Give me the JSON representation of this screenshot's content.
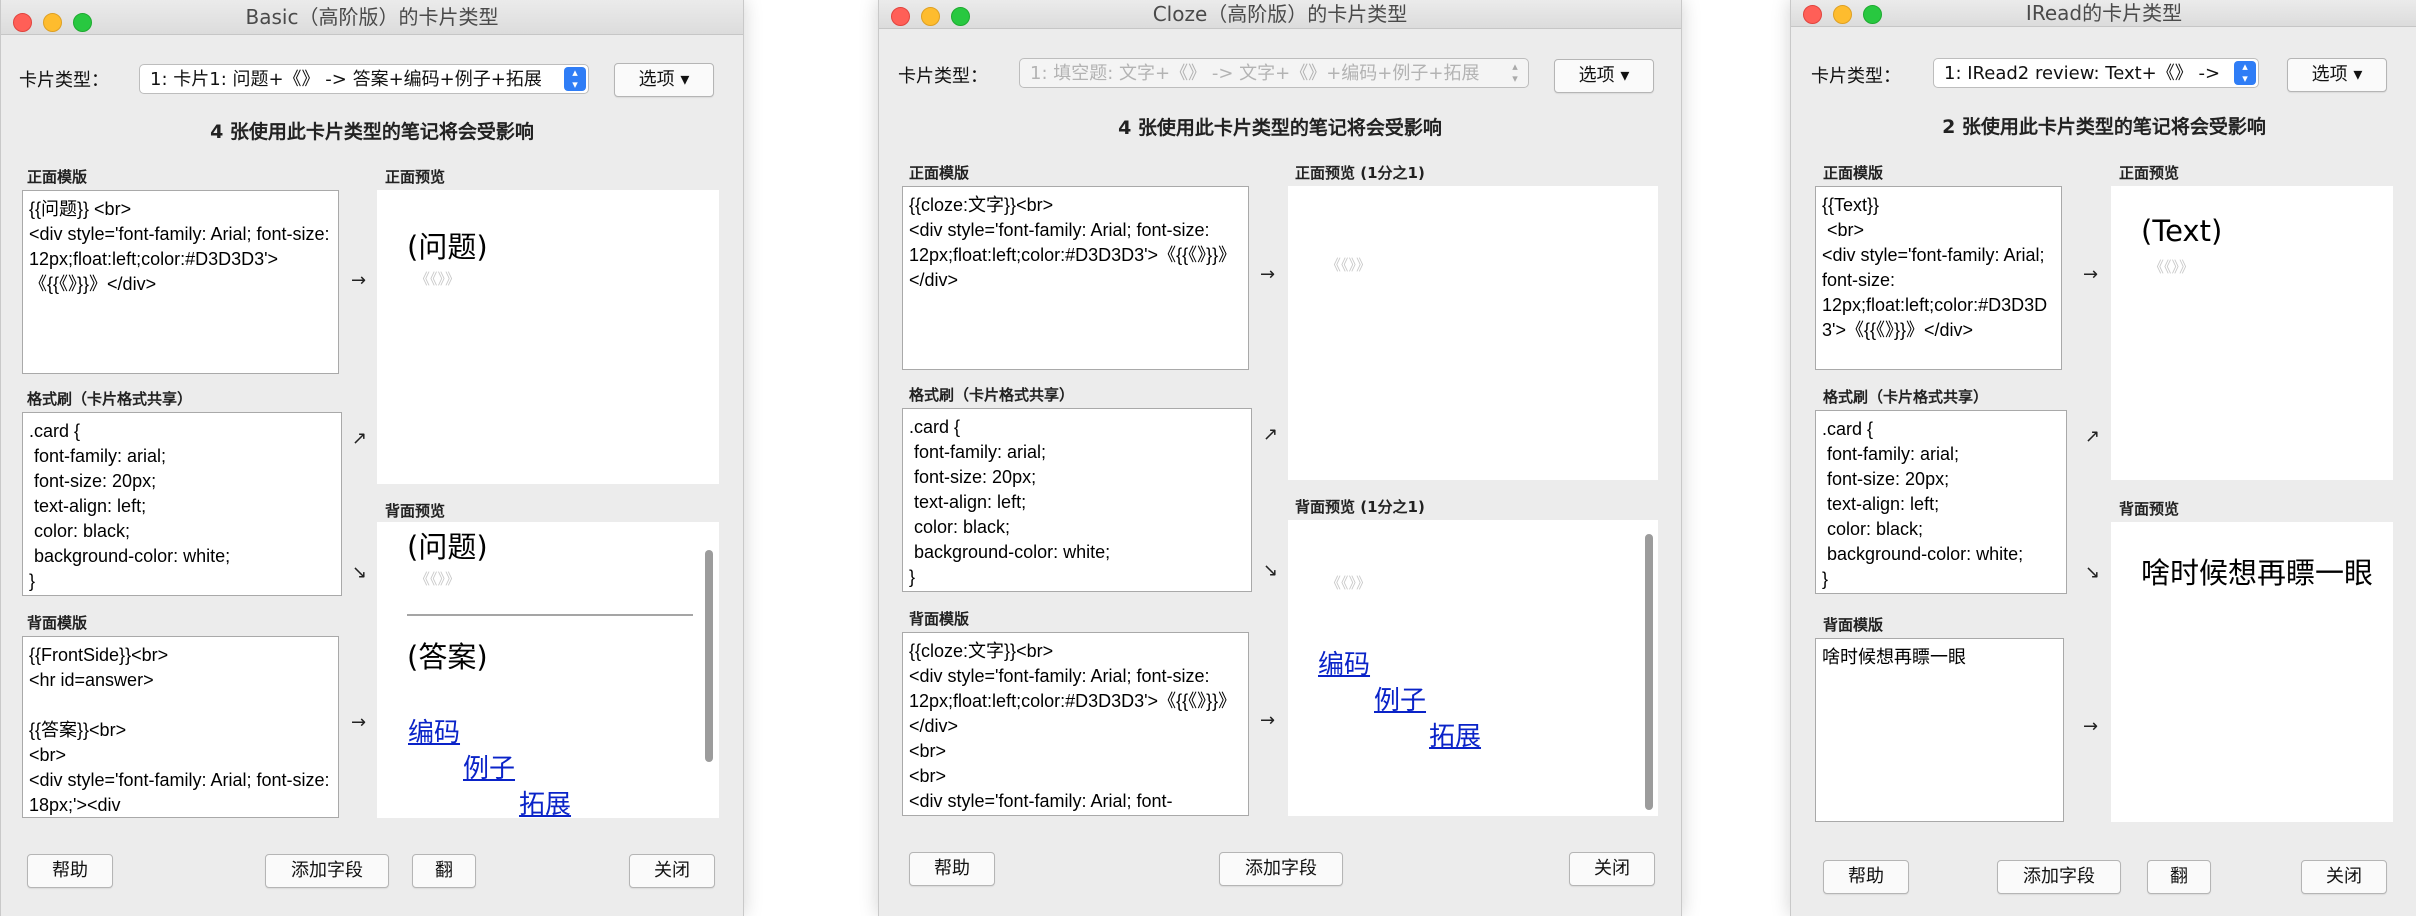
{
  "w1": {
    "title": "Basic（高阶版）的卡片类型",
    "card_type_label": "卡片类型：",
    "card_type_value": "1: 卡片1: 问题+《》 -> 答案+编码+例子+拓展",
    "options_button": "选项 ▾",
    "affected": "4 张使用此卡片类型的笔记将会受影响",
    "front_template_label": "正面模版",
    "front_template": "{{问题}} <br>\n<div style='font-family: Arial; font-size: 12px;float:left;color:#D3D3D3'>《{{《》}}》</div>",
    "front_preview_label": "正面预览",
    "front_preview_text": "(问题)",
    "front_preview_grey": "《《》》",
    "styling_label": "格式刷（卡片格式共享）",
    "styling": ".card {\n font-family: arial;\n font-size: 20px;\n text-align: left;\n color: black;\n background-color: white;\n}",
    "back_preview_label": "背面预览",
    "back_preview_q": "(问题)",
    "back_preview_grey": "《《》》",
    "back_preview_a": "(答案)",
    "link1": "编码",
    "link2": "例子",
    "link3": "拓展",
    "back_template_label": "背面模版",
    "back_template": "{{FrontSide}}<br>\n<hr id=answer>\n\n{{答案}}<br>\n<br>\n<div style='font-family: Arial; font-size: 18px;'><div",
    "help": "帮助",
    "add_field": "添加字段",
    "flip": "翻",
    "close": "关闭"
  },
  "w2": {
    "title": "Cloze（高阶版）的卡片类型",
    "card_type_label": "卡片类型：",
    "card_type_value": "1: 填空题: 文字+《》 -> 文字+《》+编码+例子+拓展",
    "options_button": "选项 ▾",
    "affected": "4 张使用此卡片类型的笔记将会受影响",
    "front_template_label": "正面模版",
    "front_template": "{{cloze:文字}}<br>\n<div style='font-family: Arial; font-size: 12px;float:left;color:#D3D3D3'>《{{《》}}》</div>",
    "front_preview_label": "正面预览 (1分之1)",
    "front_preview_grey": "《《》》",
    "styling_label": "格式刷（卡片格式共享）",
    "styling": ".card {\n font-family: arial;\n font-size: 20px;\n text-align: left;\n color: black;\n background-color: white;\n}",
    "back_preview_label": "背面预览 (1分之1)",
    "back_preview_grey": "《《》》",
    "link1": "编码",
    "link2": "例子",
    "link3": "拓展",
    "back_template_label": "背面模版",
    "back_template": "{{cloze:文字}}<br>\n<div style='font-family: Arial; font-size: 12px;float:left;color:#D3D3D3'>《{{《》}}》</div>\n<br>\n<br>\n<div style='font-family: Arial; font-",
    "help": "帮助",
    "add_field": "添加字段",
    "close": "关闭"
  },
  "w3": {
    "title": "IRead的卡片类型",
    "card_type_label": "卡片类型：",
    "card_type_value": "1: IRead2 review: Text+《》 ->",
    "options_button": "选项 ▾",
    "affected": "2 张使用此卡片类型的笔记将会受影响",
    "front_template_label": "正面模版",
    "front_template": "{{Text}}\n <br>\n<div style='font-family: Arial; font-size: 12px;float:left;color:#D3D3D3'>《{{《》}}》</div>",
    "front_preview_label": "正面预览",
    "front_preview_text": "(Text)",
    "front_preview_grey": "《《》》",
    "styling_label": "格式刷（卡片格式共享）",
    "styling": ".card {\n font-family: arial;\n font-size: 20px;\n text-align: left;\n color: black;\n background-color: white;\n}",
    "back_preview_label": "背面预览",
    "back_preview_text": "啥时候想再瞟一眼",
    "back_template_label": "背面模版",
    "back_template": "啥时候想再瞟一眼",
    "help": "帮助",
    "add_field": "添加字段",
    "flip": "翻",
    "close": "关闭"
  }
}
